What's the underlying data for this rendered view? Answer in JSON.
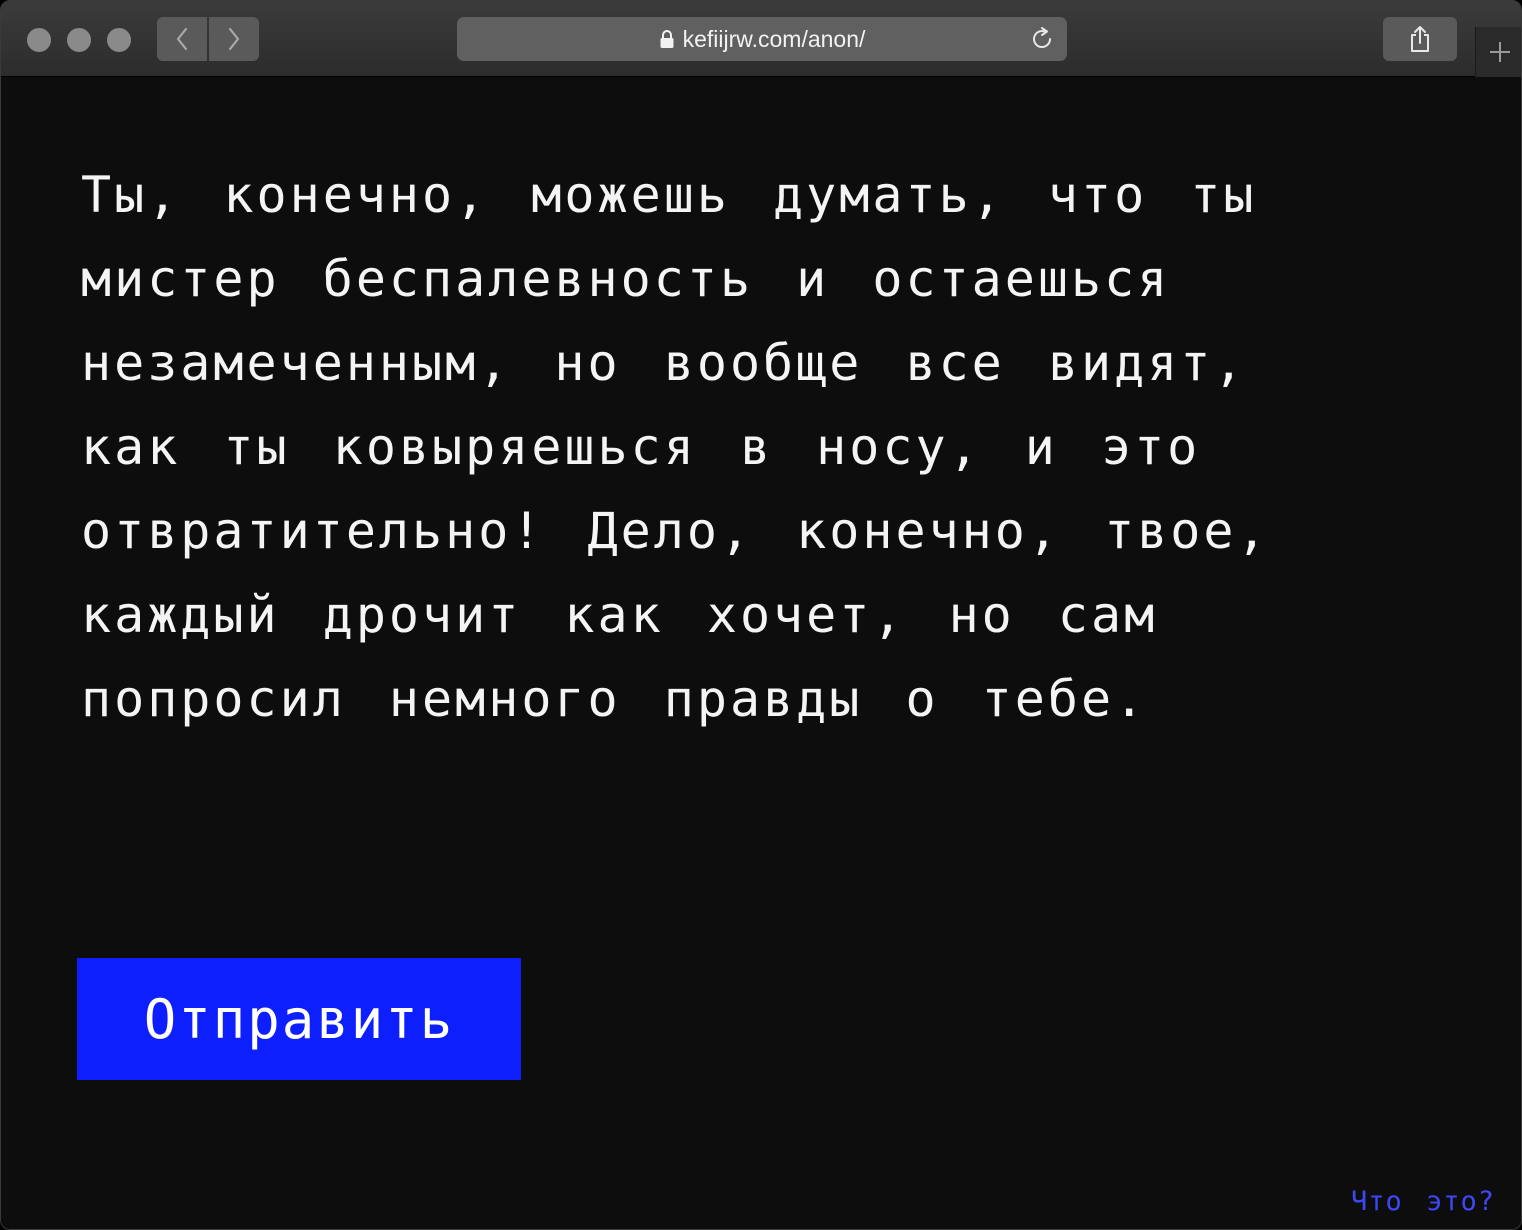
{
  "browser": {
    "url": "kefiijrw.com/anon/"
  },
  "page": {
    "message": "Ты, конечно, можешь думать, что ты мистер беспалевность и остаешься незамеченным, но вообще все видят, как ты ковыряешься в носу, и это отвратительно! Дело, конечно, твое, каждый дрочит как хочет, но сам попросил немного правды о тебе.",
    "send_label": "Отправить",
    "what_link": "Что это?"
  },
  "colors": {
    "background": "#0d0d0d",
    "accent": "#0d1ffc",
    "link": "#3d47f5"
  }
}
